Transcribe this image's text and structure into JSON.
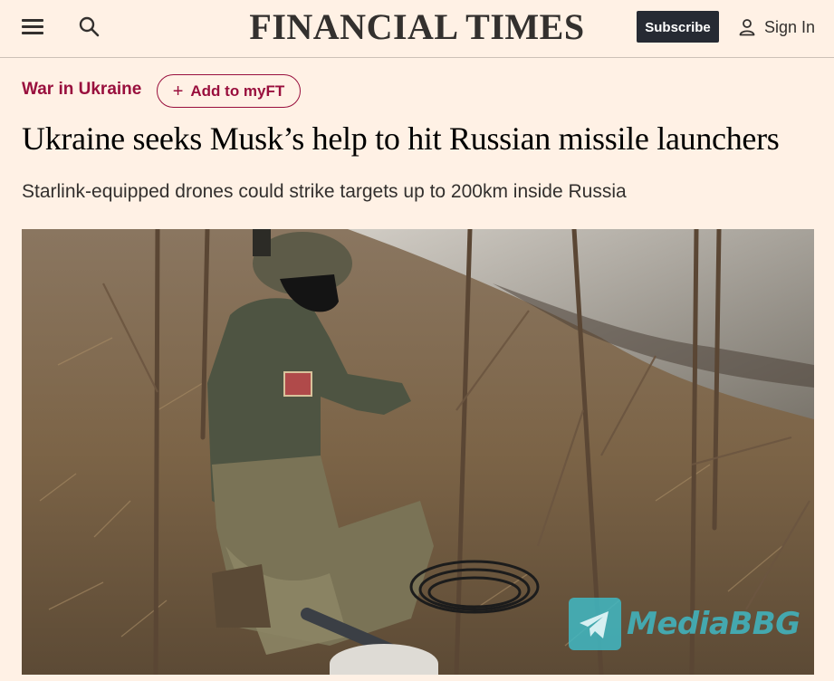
{
  "header": {
    "menu_icon": "hamburger-menu-icon",
    "search_icon": "search-icon",
    "masthead": "FINANCIAL TIMES",
    "subscribe_label": "Subscribe",
    "signin_label": "Sign In",
    "signin_icon": "user-icon"
  },
  "article": {
    "topic": "War in Ukraine",
    "myft_label": "Add to myFT",
    "myft_icon": "plus-icon",
    "headline": "Ukraine seeks Musk’s help to hit Russian missile launchers",
    "standfirst": "Starlink-equipped drones could strike targets up to 200km inside Russia"
  },
  "image": {
    "watermark_text": "MediaBBG",
    "watermark_icon": "telegram-icon"
  },
  "colors": {
    "page_background": "#fff1e5",
    "topic": "#990f3d",
    "subscribe_bg": "#262a33",
    "text": "#33302e",
    "watermark": "#3fb8c4"
  }
}
